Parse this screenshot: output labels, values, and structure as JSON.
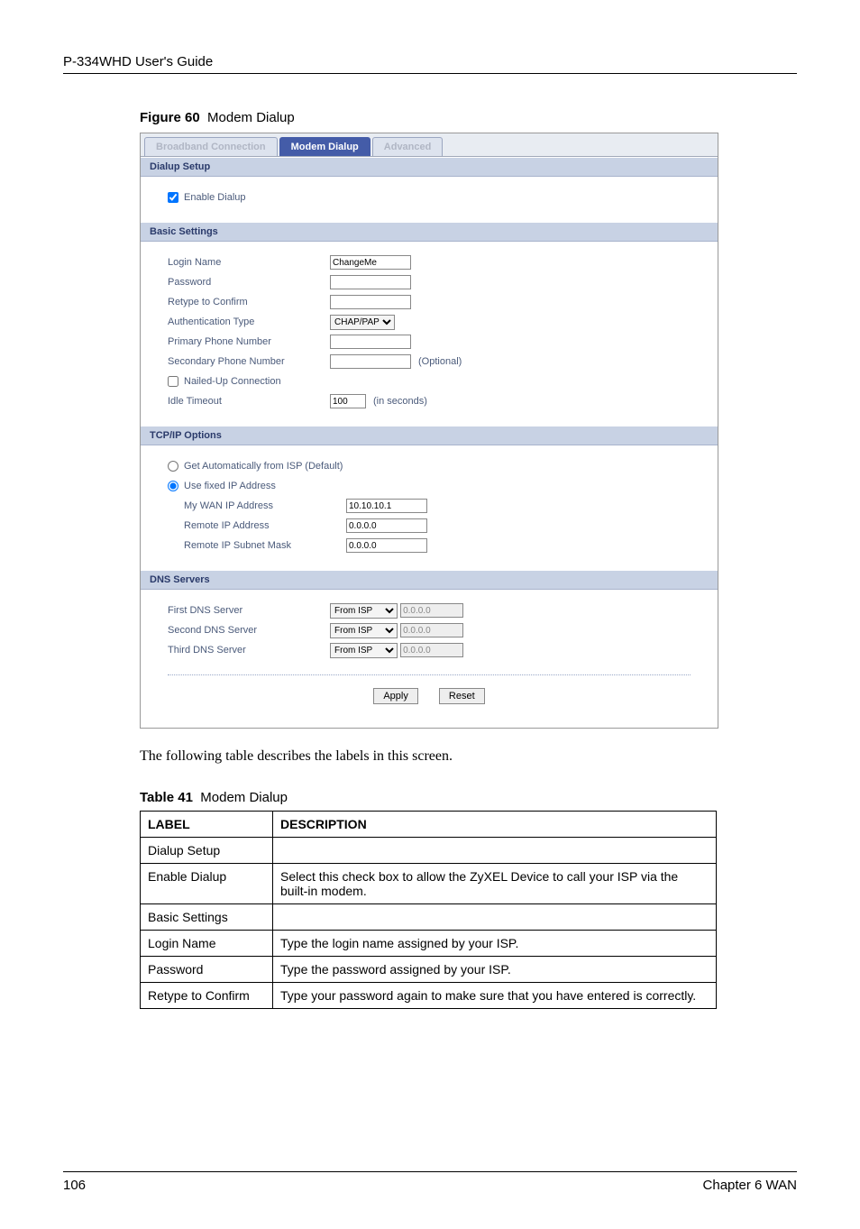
{
  "header": "P-334WHD User's Guide",
  "figure": {
    "num": "Figure 60",
    "title": "Modem Dialup"
  },
  "tabs": {
    "broadband": "Broadband Connection",
    "modem": "Modem Dialup",
    "advanced": "Advanced"
  },
  "sections": {
    "dialup_setup": "Dialup Setup",
    "basic_settings": "Basic Settings",
    "tcpip_options": "TCP/IP Options",
    "dns_servers": "DNS Servers"
  },
  "dialup": {
    "enable_label": "Enable Dialup"
  },
  "basic": {
    "login_name": "Login Name",
    "login_value": "ChangeMe",
    "password": "Password",
    "retype": "Retype to Confirm",
    "auth_type": "Authentication Type",
    "auth_value": "CHAP/PAP",
    "primary_phone": "Primary Phone Number",
    "secondary_phone": "Secondary Phone Number",
    "optional": "(Optional)",
    "nailed_up": "Nailed-Up Connection",
    "idle_timeout": "Idle Timeout",
    "idle_value": "100",
    "idle_unit": "(in seconds)"
  },
  "tcpip": {
    "auto": "Get Automatically from ISP (Default)",
    "fixed": "Use fixed IP Address",
    "my_wan": "My WAN IP Address",
    "my_wan_value": "10.10.10.1",
    "remote_ip": "Remote IP Address",
    "remote_ip_value": "0.0.0.0",
    "remote_mask": "Remote IP Subnet Mask",
    "remote_mask_value": "0.0.0.0"
  },
  "dns": {
    "first": "First DNS Server",
    "second": "Second DNS Server",
    "third": "Third DNS Server",
    "from_isp": "From ISP",
    "value": "0.0.0.0"
  },
  "buttons": {
    "apply": "Apply",
    "reset": "Reset"
  },
  "intro": "The following table describes the labels in this screen.",
  "table": {
    "caption_num": "Table 41",
    "caption_title": "Modem Dialup",
    "head_label": "LABEL",
    "head_desc": "DESCRIPTION",
    "rows": [
      {
        "label": "Dialup Setup",
        "desc": ""
      },
      {
        "label": "Enable Dialup",
        "desc": "Select this check box to allow the ZyXEL Device to call your ISP via the built-in modem."
      },
      {
        "label": "Basic Settings",
        "desc": ""
      },
      {
        "label": "Login Name",
        "desc": "Type the login name assigned by your ISP."
      },
      {
        "label": "Password",
        "desc": "Type the password assigned by your ISP."
      },
      {
        "label": "Retype to Confirm",
        "desc": "Type your password again to make sure that you have entered is correctly."
      }
    ]
  },
  "footer": {
    "page": "106",
    "chapter": "Chapter 6 WAN"
  }
}
